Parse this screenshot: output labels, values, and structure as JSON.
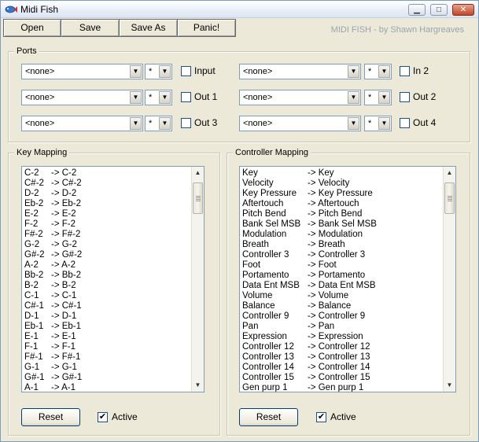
{
  "window": {
    "title": "Midi Fish"
  },
  "titlebar": {
    "minimize": "▁",
    "maximize": "□",
    "close": "✕"
  },
  "toolbar": {
    "open": "Open",
    "save": "Save",
    "save_as": "Save As",
    "panic": "Panic!"
  },
  "credit": "MIDI FISH - by Shawn Hargreaves",
  "ports": {
    "label": "Ports",
    "rows": [
      {
        "left": {
          "device": "<none>",
          "channel": "*",
          "checkbox": "Input",
          "checked": false
        },
        "right": {
          "device": "<none>",
          "channel": "*",
          "checkbox": "In 2",
          "checked": false
        }
      },
      {
        "left": {
          "device": "<none>",
          "channel": "*",
          "checkbox": "Out 1",
          "checked": false
        },
        "right": {
          "device": "<none>",
          "channel": "*",
          "checkbox": "Out 2",
          "checked": false
        }
      },
      {
        "left": {
          "device": "<none>",
          "channel": "*",
          "checkbox": "Out 3",
          "checked": false
        },
        "right": {
          "device": "<none>",
          "channel": "*",
          "checkbox": "Out 4",
          "checked": false
        }
      }
    ]
  },
  "key_mapping": {
    "label": "Key Mapping",
    "rows": [
      [
        "C-2",
        "-> C-2"
      ],
      [
        "C#-2",
        "-> C#-2"
      ],
      [
        "D-2",
        "-> D-2"
      ],
      [
        "Eb-2",
        "-> Eb-2"
      ],
      [
        "E-2",
        "-> E-2"
      ],
      [
        "F-2",
        "-> F-2"
      ],
      [
        "F#-2",
        "-> F#-2"
      ],
      [
        "G-2",
        "-> G-2"
      ],
      [
        "G#-2",
        "-> G#-2"
      ],
      [
        "A-2",
        "-> A-2"
      ],
      [
        "Bb-2",
        "-> Bb-2"
      ],
      [
        "B-2",
        "-> B-2"
      ],
      [
        "C-1",
        "-> C-1"
      ],
      [
        "C#-1",
        "-> C#-1"
      ],
      [
        "D-1",
        "-> D-1"
      ],
      [
        "Eb-1",
        "-> Eb-1"
      ],
      [
        "E-1",
        "-> E-1"
      ],
      [
        "F-1",
        "-> F-1"
      ],
      [
        "F#-1",
        "-> F#-1"
      ],
      [
        "G-1",
        "-> G-1"
      ],
      [
        "G#-1",
        "-> G#-1"
      ],
      [
        "A-1",
        "-> A-1"
      ]
    ],
    "reset": "Reset",
    "active_label": "Active",
    "active_checked": true
  },
  "controller_mapping": {
    "label": "Controller Mapping",
    "rows": [
      [
        "Key",
        "-> Key"
      ],
      [
        "Velocity",
        "-> Velocity"
      ],
      [
        "Key Pressure",
        "-> Key Pressure"
      ],
      [
        "Aftertouch",
        "-> Aftertouch"
      ],
      [
        "Pitch Bend",
        "-> Pitch Bend"
      ],
      [
        "Bank Sel MSB",
        "-> Bank Sel MSB"
      ],
      [
        "Modulation",
        "-> Modulation"
      ],
      [
        "Breath",
        "-> Breath"
      ],
      [
        "Controller 3",
        "-> Controller 3"
      ],
      [
        "Foot",
        "-> Foot"
      ],
      [
        "Portamento",
        "-> Portamento"
      ],
      [
        "Data Ent MSB",
        "-> Data Ent MSB"
      ],
      [
        "Volume",
        "-> Volume"
      ],
      [
        "Balance",
        "-> Balance"
      ],
      [
        "Controller 9",
        "-> Controller 9"
      ],
      [
        "Pan",
        "-> Pan"
      ],
      [
        "Expression",
        "-> Expression"
      ],
      [
        "Controller 12",
        "-> Controller 12"
      ],
      [
        "Controller 13",
        "-> Controller 13"
      ],
      [
        "Controller 14",
        "-> Controller 14"
      ],
      [
        "Controller 15",
        "-> Controller 15"
      ],
      [
        "Gen purp 1",
        "-> Gen purp 1"
      ]
    ],
    "reset": "Reset",
    "active_label": "Active",
    "active_checked": true
  },
  "icons": {
    "app": "fish-icon",
    "dropdown": "chevron-down-icon",
    "scroll_up": "arrow-up-icon",
    "scroll_down": "arrow-down-icon",
    "check": "checkmark-icon"
  }
}
